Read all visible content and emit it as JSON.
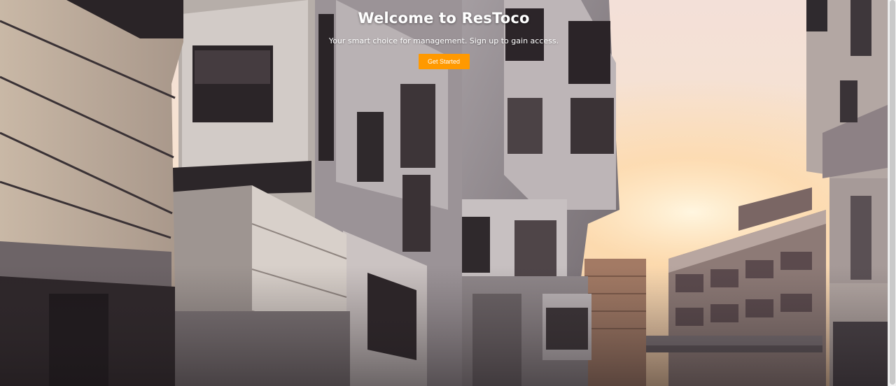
{
  "hero": {
    "title": "Welcome to ResToco",
    "subtitle": "Your smart choice for management. Sign up to gain access.",
    "cta_label": "Get Started"
  },
  "colors": {
    "accent": "#ff9900",
    "sky": "#f6e4d6",
    "sun": "#ffe9b8"
  }
}
